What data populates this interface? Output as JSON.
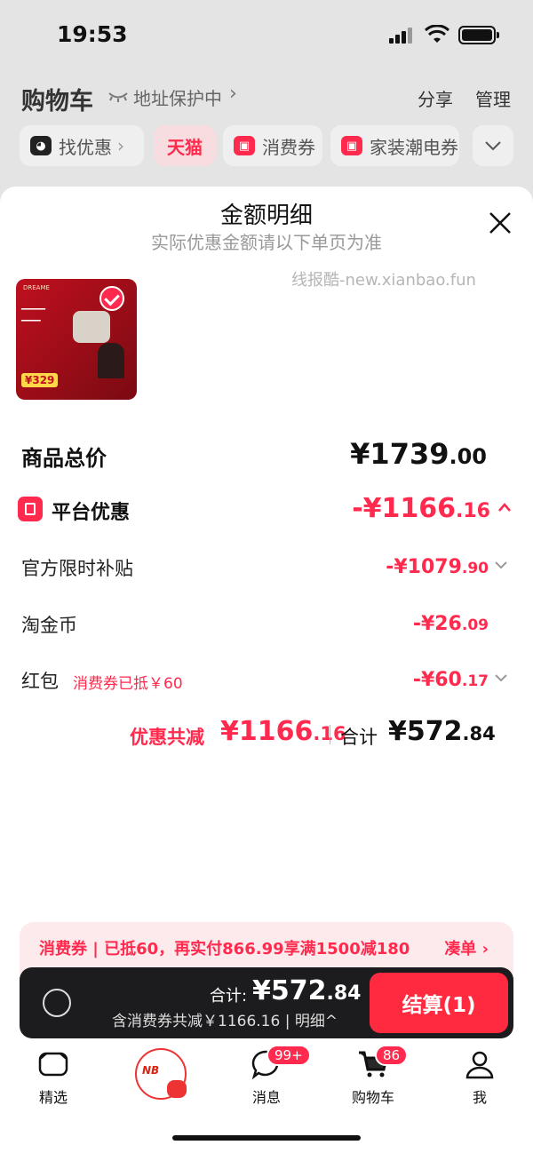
{
  "status_bar": {
    "time": "19:53"
  },
  "header": {
    "title": "购物车",
    "address_protect": "地址保护中",
    "share": "分享",
    "manage": "管理"
  },
  "chips": [
    {
      "label": "找优惠"
    },
    {
      "label": "天猫"
    },
    {
      "label": "消费券"
    },
    {
      "label": "家装潮电券"
    }
  ],
  "sheet": {
    "title": "金额明细",
    "subtitle": "实际优惠金额请以下单页为准",
    "watermark": "线报酷-new.xianbao.fun",
    "product": {
      "price_tag": "¥329"
    }
  },
  "breakdown": {
    "total": {
      "label": "商品总价",
      "amount_main": "¥1739",
      "amount_cents": ".00"
    },
    "platform": {
      "label": "平台优惠",
      "amount_main": "-¥1166",
      "amount_cents": ".16"
    },
    "subsidy": {
      "label": "官方限时补贴",
      "amount_main": "-¥1079",
      "amount_cents": ".90"
    },
    "coins": {
      "label": "淘金币",
      "amount_main": "-¥26",
      "amount_cents": ".09"
    },
    "redpacket": {
      "label": "红包",
      "note": "消费券已抵￥60",
      "amount_main": "-¥60",
      "amount_cents": ".17"
    }
  },
  "summary": {
    "discount_label": "优惠共减",
    "discount_main": "¥1166",
    "discount_cents": ".16",
    "total_label": "合计",
    "total_main": "¥572",
    "total_cents": ".84"
  },
  "coupon_banner": {
    "text": "消费券 | 已抵60，再实付866.99享满1500减180",
    "link": "凑单 ›"
  },
  "checkout": {
    "sum_label": "合计:",
    "sum_main": "¥572",
    "sum_cents": ".84",
    "sub": "含消费券共减￥1166.16 | 明细^",
    "button": "结算(1)"
  },
  "tabbar": [
    {
      "label": "精选"
    },
    {
      "label": ""
    },
    {
      "label": "消息",
      "badge": "99+"
    },
    {
      "label": "购物车",
      "badge": "86"
    },
    {
      "label": "我"
    }
  ],
  "colors": {
    "accent": "#ff2a4d",
    "dark_bar": "#1c1c1e"
  }
}
